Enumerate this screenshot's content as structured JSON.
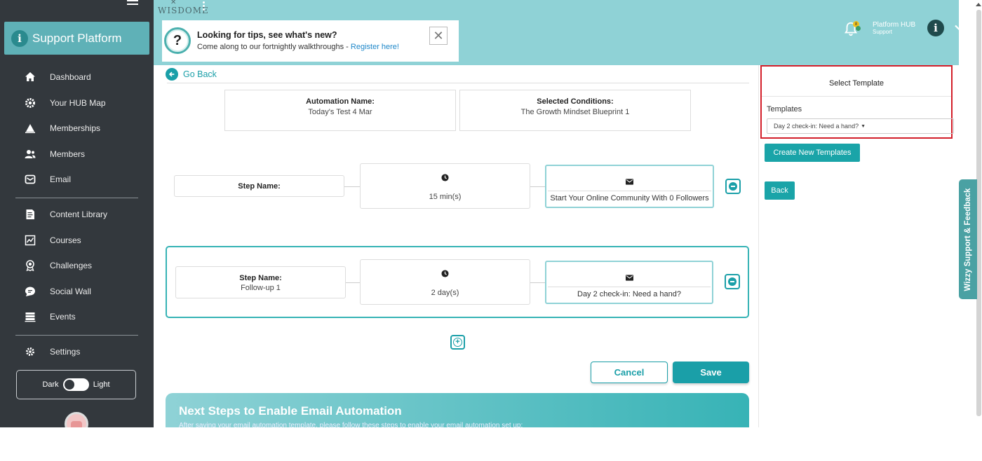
{
  "sidebar": {
    "brand": "Support Platform",
    "nav_main": [
      {
        "label": "Dashboard",
        "icon": "home-icon"
      },
      {
        "label": "Your HUB Map",
        "icon": "gear-icon"
      },
      {
        "label": "Memberships",
        "icon": "triangle-icon"
      },
      {
        "label": "Members",
        "icon": "users-icon"
      },
      {
        "label": "Email",
        "icon": "mail-icon"
      }
    ],
    "nav_content": [
      {
        "label": "Content Library",
        "icon": "document-icon"
      },
      {
        "label": "Courses",
        "icon": "chart-icon"
      },
      {
        "label": "Challenges",
        "icon": "award-icon"
      },
      {
        "label": "Social Wall",
        "icon": "chat-icon"
      },
      {
        "label": "Events",
        "icon": "calendar-icon"
      }
    ],
    "settings_label": "Settings",
    "theme": {
      "dark_label": "Dark",
      "light_label": "Light"
    }
  },
  "header": {
    "logo": "WISDOME",
    "tips": {
      "title": "Looking for tips, see what's new?",
      "body": "Come along to our fortnightly walkthroughs - ",
      "link": "Register here!"
    },
    "notifications_count": "8",
    "hub_title": "Platform HUB",
    "hub_subtitle": "Support"
  },
  "main": {
    "go_back": "Go Back",
    "automation_name": {
      "label": "Automation Name:",
      "value": "Today's Test 4 Mar"
    },
    "selected_conditions": {
      "label": "Selected Conditions:",
      "value": "The Growth Mindset Blueprint 1"
    },
    "steps": [
      {
        "name_label": "Step Name:",
        "name": "",
        "delay": "15 min(s)",
        "email": "Start Your Online Community With 0 Followers"
      },
      {
        "name_label": "Step Name:",
        "name": "Follow-up 1",
        "delay": "2 day(s)",
        "email": "Day 2 check-in: Need a hand?"
      }
    ],
    "cancel_label": "Cancel",
    "save_label": "Save",
    "next_steps": {
      "title": "Next Steps to Enable Email Automation",
      "subtitle": "After saving your email automation template, please follow these steps to enable your email automation set up:"
    }
  },
  "panel": {
    "title": "Select Template",
    "templates_label": "Templates",
    "selected_template": "Day 2 check-in: Need a hand?",
    "create_label": "Create New Templates",
    "back_label": "Back"
  },
  "feedback_label": "Wizzy Support & Feedback",
  "colors": {
    "accent": "#1a9fa8",
    "sidebar": "#33383d",
    "topbar": "#8fd2d6",
    "highlight": "#d31f2a"
  }
}
